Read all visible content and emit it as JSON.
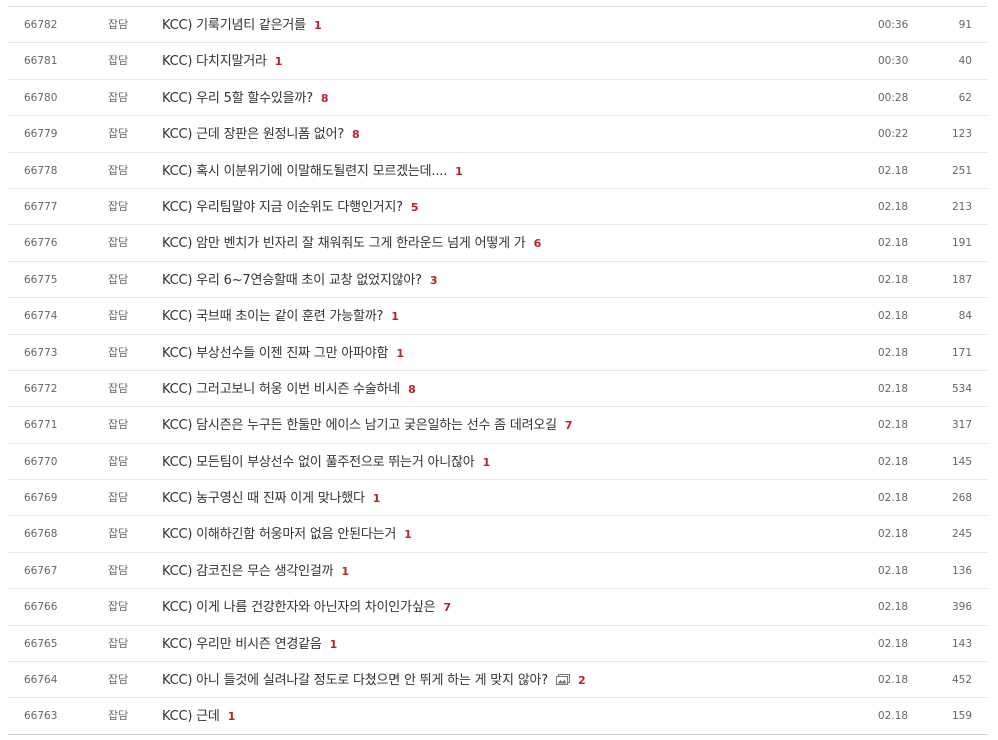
{
  "posts": [
    {
      "no": "66782",
      "category": "잡담",
      "title": "KCC) 기룩기념티 같은거를",
      "comments": "1",
      "has_image": false,
      "time": "00:36",
      "views": "91"
    },
    {
      "no": "66781",
      "category": "잡담",
      "title": "KCC) 다치지말거라",
      "comments": "1",
      "has_image": false,
      "time": "00:30",
      "views": "40"
    },
    {
      "no": "66780",
      "category": "잡담",
      "title": "KCC) 우리 5할 할수있을까?",
      "comments": "8",
      "has_image": false,
      "time": "00:28",
      "views": "62"
    },
    {
      "no": "66779",
      "category": "잡담",
      "title": "KCC) 근데 장판은 원정니폼 없어?",
      "comments": "8",
      "has_image": false,
      "time": "00:22",
      "views": "123"
    },
    {
      "no": "66778",
      "category": "잡담",
      "title": "KCC) 혹시 이분위기에 이말해도될련지 모르겠는데....",
      "comments": "1",
      "has_image": false,
      "time": "02.18",
      "views": "251"
    },
    {
      "no": "66777",
      "category": "잡담",
      "title": "KCC) 우리팀말야 지금 이순위도 다행인거지?",
      "comments": "5",
      "has_image": false,
      "time": "02.18",
      "views": "213"
    },
    {
      "no": "66776",
      "category": "잡담",
      "title": "KCC) 암만 벤치가 빈자리 잘 채워줘도 그게 한라운드 넘게 어떻게 가",
      "comments": "6",
      "has_image": false,
      "time": "02.18",
      "views": "191"
    },
    {
      "no": "66775",
      "category": "잡담",
      "title": "KCC) 우리 6~7연승할때 초이 교창 없었지않아?",
      "comments": "3",
      "has_image": false,
      "time": "02.18",
      "views": "187"
    },
    {
      "no": "66774",
      "category": "잡담",
      "title": "KCC) 국브때 초이는 같이 훈련 가능할까?",
      "comments": "1",
      "has_image": false,
      "time": "02.18",
      "views": "84"
    },
    {
      "no": "66773",
      "category": "잡담",
      "title": "KCC) 부상선수들 이젠 진짜 그만 아파야함",
      "comments": "1",
      "has_image": false,
      "time": "02.18",
      "views": "171"
    },
    {
      "no": "66772",
      "category": "잡담",
      "title": "KCC) 그러고보니 허웅 이번 비시즌 수술하네",
      "comments": "8",
      "has_image": false,
      "time": "02.18",
      "views": "534"
    },
    {
      "no": "66771",
      "category": "잡담",
      "title": "KCC) 담시즌은 누구든 한둘만 에이스 남기고 궂은일하는 선수 좀 데려오길",
      "comments": "7",
      "has_image": false,
      "time": "02.18",
      "views": "317"
    },
    {
      "no": "66770",
      "category": "잡담",
      "title": "KCC) 모든팀이 부상선수 없이 풀주전으로 뛰는거 아니잖아",
      "comments": "1",
      "has_image": false,
      "time": "02.18",
      "views": "145"
    },
    {
      "no": "66769",
      "category": "잡담",
      "title": "KCC) 농구영신 때 진짜 이게 맞나했다",
      "comments": "1",
      "has_image": false,
      "time": "02.18",
      "views": "268"
    },
    {
      "no": "66768",
      "category": "잡담",
      "title": "KCC) 이해하긴함 허웅마저 없음 안된다는거",
      "comments": "1",
      "has_image": false,
      "time": "02.18",
      "views": "245"
    },
    {
      "no": "66767",
      "category": "잡담",
      "title": "KCC) 감코진은 무슨 생각인걸까",
      "comments": "1",
      "has_image": false,
      "time": "02.18",
      "views": "136"
    },
    {
      "no": "66766",
      "category": "잡담",
      "title": "KCC) 이게 나름 건강한자와 아닌자의 차이인가싶은",
      "comments": "7",
      "has_image": false,
      "time": "02.18",
      "views": "396"
    },
    {
      "no": "66765",
      "category": "잡담",
      "title": "KCC) 우리만 비시즌 연경같음",
      "comments": "1",
      "has_image": false,
      "time": "02.18",
      "views": "143"
    },
    {
      "no": "66764",
      "category": "잡담",
      "title": "KCC) 아니 들것에 실려나갈 정도로 다쳤으면 안 뛰게 하는 게 맞지 않아?",
      "comments": "2",
      "has_image": true,
      "time": "02.18",
      "views": "452"
    },
    {
      "no": "66763",
      "category": "잡담",
      "title": "KCC) 근데",
      "comments": "1",
      "has_image": false,
      "time": "02.18",
      "views": "159"
    }
  ],
  "colors": {
    "comment_count": "#b8232b",
    "row_divider": "#e8e8e8",
    "text": "#333333",
    "meta_text": "#666666"
  },
  "icons": {
    "image_attachment": "image-icon"
  }
}
